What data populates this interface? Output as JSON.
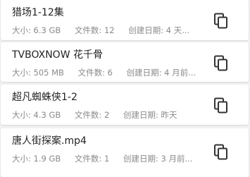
{
  "items": [
    {
      "title": "猎场1-12集",
      "size": "大小: 6.3 GB",
      "file_count": "文件数: 12",
      "created": "创建日期: 4 天..."
    },
    {
      "title": "TVBOXNOW 花千骨",
      "size": "大小: 505 MB",
      "file_count": "文件数: 6",
      "created": "创建日期: 4 月前..."
    },
    {
      "title": "超凡蜘蛛侠1-2",
      "size": "大小: 4.3 GB",
      "file_count": "文件数: 2",
      "created": "创建日期: 昨天"
    },
    {
      "title": "唐人街探案.mp4",
      "size": "大小: 1.9 GB",
      "file_count": "文件数: 1",
      "created": "创建日期: 3 月前..."
    }
  ],
  "icons": {
    "copy": "copy-icon"
  },
  "colors": {
    "background": "#f2f2f2",
    "card": "#ffffff",
    "title_text": "#222222",
    "meta_text": "#8a8a8a",
    "icon": "#333333"
  }
}
